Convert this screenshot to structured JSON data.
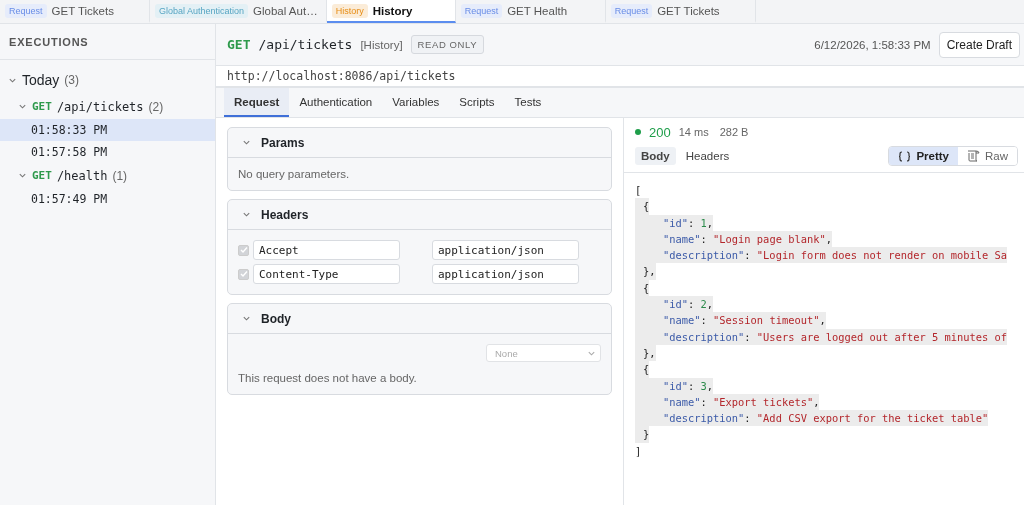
{
  "tabs": [
    {
      "badge": "Request",
      "color": "#e6ecfb",
      "label": "GET Tickets",
      "selected": false
    },
    {
      "badge": "Global Authentication",
      "color": "#e3f0f5",
      "label": "Global Aut…",
      "selected": false
    },
    {
      "badge": "History",
      "color": "#fbecd8",
      "label": "History",
      "selected": true
    },
    {
      "badge": "Request",
      "color": "#e6ecfb",
      "label": "GET Health",
      "selected": false
    },
    {
      "badge": "Request",
      "color": "#e6ecfb",
      "label": "GET Tickets",
      "selected": false
    }
  ],
  "sidebar": {
    "title": "EXECUTIONS",
    "tree": [
      {
        "label": "Today",
        "count": "(3)",
        "expanded": true,
        "children": [
          {
            "method": "GET",
            "label": "/api/tickets",
            "count": "(2)",
            "expanded": true,
            "children": [
              {
                "label": "01:58:33 PM",
                "selected": true
              },
              {
                "label": "01:57:58 PM",
                "selected": false
              }
            ]
          },
          {
            "method": "GET",
            "label": "/health",
            "count": "(1)",
            "expanded": true,
            "children": [
              {
                "label": "01:57:49 PM",
                "selected": false
              }
            ]
          }
        ]
      }
    ]
  },
  "request": {
    "method": "GET",
    "path": "/api/tickets",
    "tag": "[History]",
    "badge": "READ ONLY",
    "timestamp": "6/12/2026, 1:58:33 PM",
    "create_button": "Create Draft",
    "url": "http://localhost:8086/api/tickets",
    "tabs": [
      {
        "label": "Request",
        "selected": true
      },
      {
        "label": "Authentication",
        "selected": false
      },
      {
        "label": "Variables",
        "selected": false
      },
      {
        "label": "Scripts",
        "selected": false
      },
      {
        "label": "Tests",
        "selected": false
      }
    ],
    "sections": [
      {
        "kind": "params",
        "title": "Params",
        "expanded": true,
        "empty_text": "No query parameters."
      },
      {
        "kind": "headers",
        "title": "Headers",
        "expanded": true,
        "rows": [
          {
            "checked": true,
            "key": "Accept",
            "value": "application/json"
          },
          {
            "checked": true,
            "key": "Content-Type",
            "value": "application/json"
          }
        ]
      },
      {
        "kind": "body",
        "title": "Body",
        "expanded": true,
        "select": "None",
        "empty_text": "This request does not have a body."
      }
    ]
  },
  "response": {
    "status": "200",
    "time": "14 ms",
    "size": "282 B",
    "tabs": [
      {
        "label": "Body",
        "selected": true
      },
      {
        "label": "Headers",
        "selected": false
      }
    ],
    "views": [
      {
        "label": "Pretty",
        "kind": "braces",
        "selected": true
      },
      {
        "label": "Raw",
        "kind": "scroll",
        "selected": false
      }
    ],
    "lines": [
      {
        "kind": "outer",
        "tokens": [
          {
            "kind": "punct",
            "text": "["
          }
        ]
      },
      {
        "kind": "brace",
        "tokens": [
          {
            "kind": "punct",
            "text": "{"
          }
        ]
      },
      {
        "kind": "field",
        "tokens": [
          {
            "kind": "key",
            "text": "\"id\""
          },
          {
            "kind": "punct",
            "text": ":"
          },
          {
            "kind": "number",
            "text": "1"
          },
          {
            "kind": "punct",
            "text": ","
          }
        ]
      },
      {
        "kind": "field",
        "tokens": [
          {
            "kind": "key",
            "text": "\"name\""
          },
          {
            "kind": "punct",
            "text": ":"
          },
          {
            "kind": "string",
            "text": "\"Login page blank\""
          },
          {
            "kind": "punct",
            "text": ","
          }
        ]
      },
      {
        "kind": "field",
        "tokens": [
          {
            "kind": "key",
            "text": "\"description\""
          },
          {
            "kind": "punct",
            "text": ":"
          },
          {
            "kind": "string",
            "text": "\"Login form does not render on mobile Sa"
          }
        ]
      },
      {
        "kind": "brace",
        "tokens": [
          {
            "kind": "punct",
            "text": "},"
          }
        ]
      },
      {
        "kind": "brace",
        "tokens": [
          {
            "kind": "punct",
            "text": "{"
          }
        ]
      },
      {
        "kind": "field",
        "tokens": [
          {
            "kind": "key",
            "text": "\"id\""
          },
          {
            "kind": "punct",
            "text": ":"
          },
          {
            "kind": "number",
            "text": "2"
          },
          {
            "kind": "punct",
            "text": ","
          }
        ]
      },
      {
        "kind": "field",
        "tokens": [
          {
            "kind": "key",
            "text": "\"name\""
          },
          {
            "kind": "punct",
            "text": ":"
          },
          {
            "kind": "string",
            "text": "\"Session timeout\""
          },
          {
            "kind": "punct",
            "text": ","
          }
        ]
      },
      {
        "kind": "field",
        "tokens": [
          {
            "kind": "key",
            "text": "\"description\""
          },
          {
            "kind": "punct",
            "text": ":"
          },
          {
            "kind": "string",
            "text": "\"Users are logged out after 5 minutes of"
          }
        ]
      },
      {
        "kind": "brace",
        "tokens": [
          {
            "kind": "punct",
            "text": "},"
          }
        ]
      },
      {
        "kind": "brace",
        "tokens": [
          {
            "kind": "punct",
            "text": "{"
          }
        ]
      },
      {
        "kind": "field",
        "tokens": [
          {
            "kind": "key",
            "text": "\"id\""
          },
          {
            "kind": "punct",
            "text": ":"
          },
          {
            "kind": "number",
            "text": "3"
          },
          {
            "kind": "punct",
            "text": ","
          }
        ]
      },
      {
        "kind": "field",
        "tokens": [
          {
            "kind": "key",
            "text": "\"name\""
          },
          {
            "kind": "punct",
            "text": ":"
          },
          {
            "kind": "string",
            "text": "\"Export tickets\""
          },
          {
            "kind": "punct",
            "text": ","
          }
        ]
      },
      {
        "kind": "field",
        "tokens": [
          {
            "kind": "key",
            "text": "\"description\""
          },
          {
            "kind": "punct",
            "text": ":"
          },
          {
            "kind": "string",
            "text": "\"Add CSV export for the ticket table\""
          }
        ]
      },
      {
        "kind": "brace",
        "tokens": [
          {
            "kind": "punct",
            "text": "}"
          }
        ]
      },
      {
        "kind": "outer",
        "tokens": [
          {
            "kind": "punct",
            "text": "]"
          }
        ]
      }
    ]
  }
}
